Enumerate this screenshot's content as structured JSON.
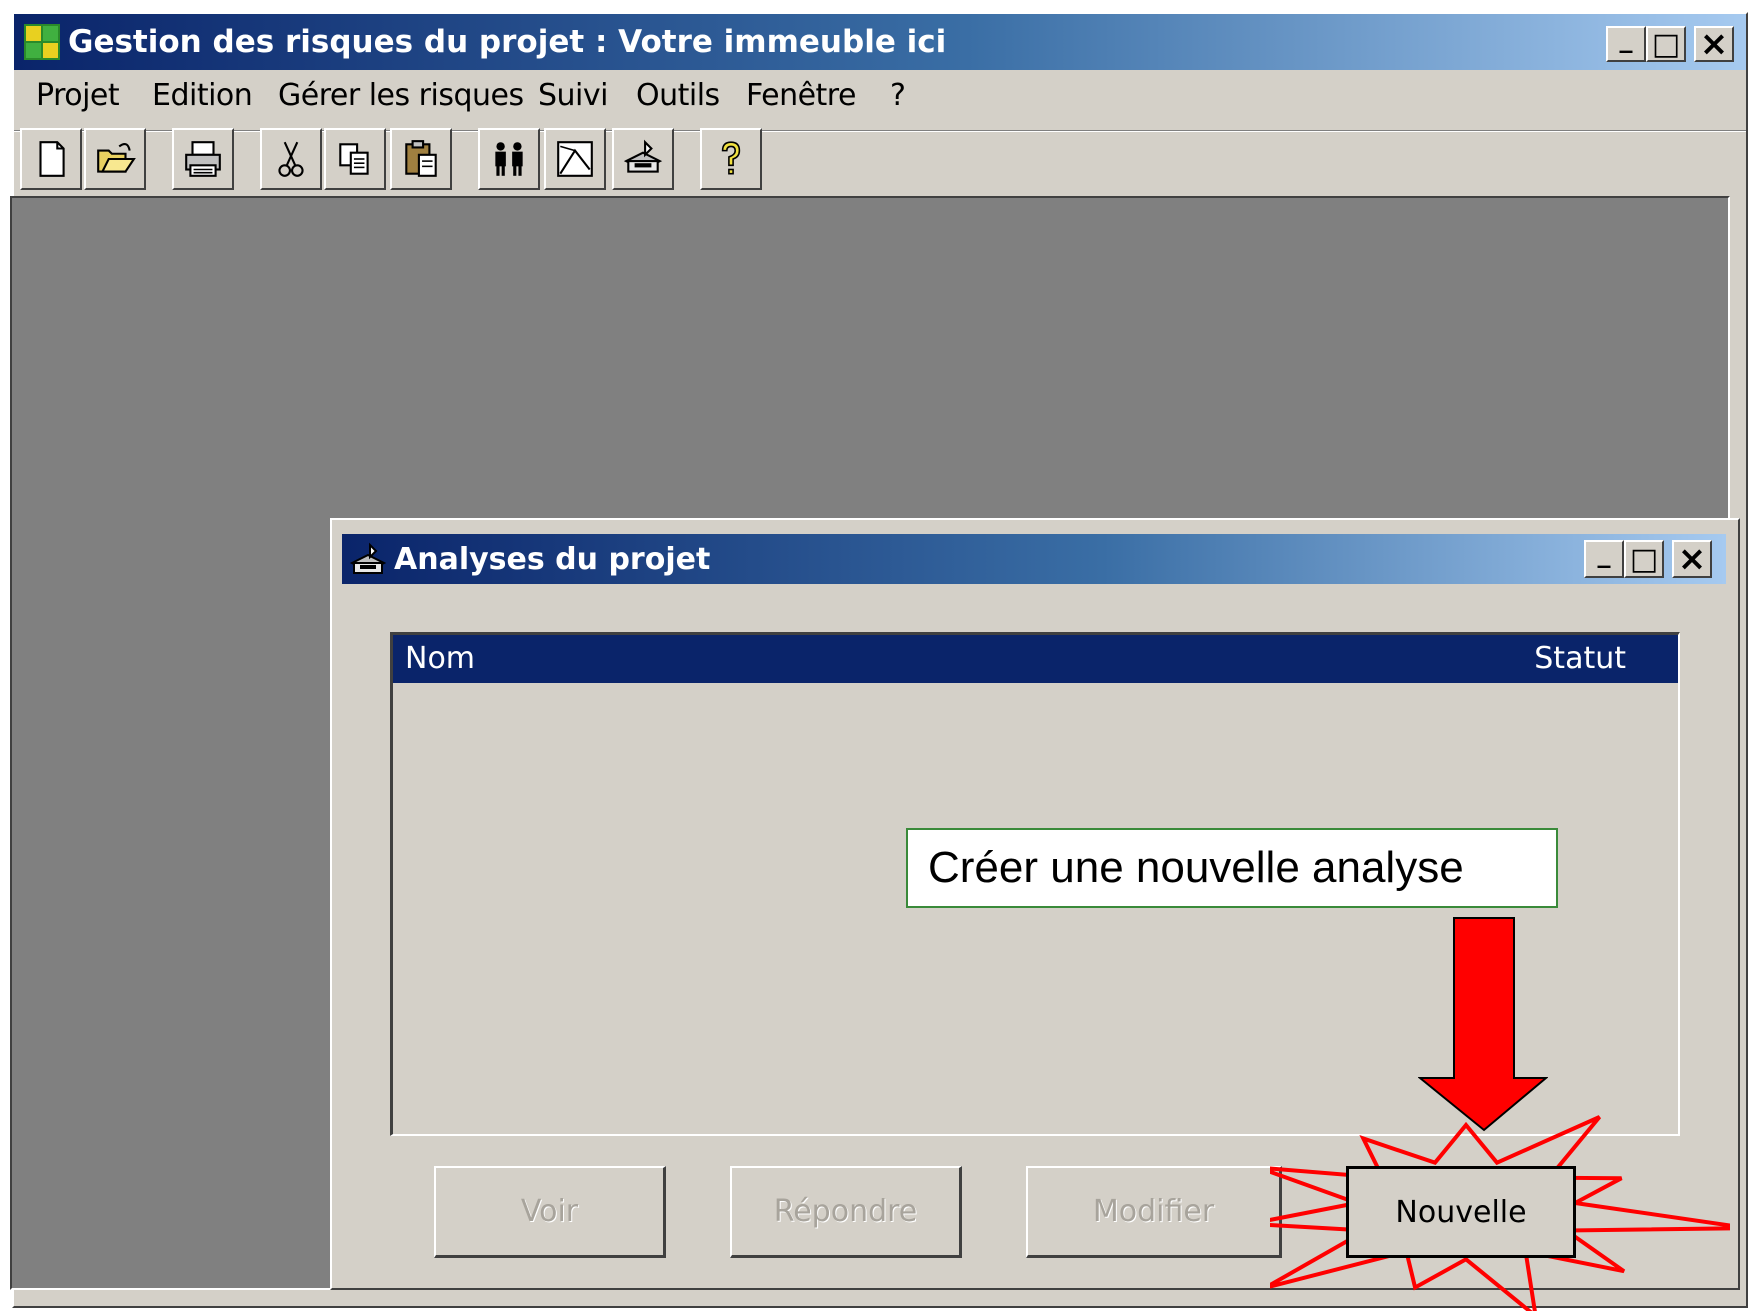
{
  "main_window": {
    "title": "Gestion des risques du projet : Votre immeuble ici",
    "controls": {
      "minimize": "_",
      "maximize": "□",
      "close": "×"
    }
  },
  "menu": {
    "items": [
      "Projet",
      "Edition",
      "Gérer les risques",
      "Suivi",
      "Outils",
      "Fenêtre",
      "?"
    ]
  },
  "toolbar": {
    "buttons": [
      "new-file-icon",
      "open-folder-icon",
      "print-icon",
      "cut-icon",
      "copy-icon",
      "paste-icon",
      "people-icon",
      "chart-icon",
      "analysis-icon",
      "help-icon"
    ]
  },
  "child_window": {
    "title": "Analyses du projet",
    "controls": {
      "minimize": "_",
      "maximize": "□",
      "close": "×"
    },
    "list": {
      "columns": [
        "Nom",
        "Statut"
      ],
      "rows": []
    },
    "buttons": {
      "voir": "Voir",
      "repondre": "Répondre",
      "modifier": "Modifier",
      "nouvelle": "Nouvelle"
    }
  },
  "annotation": {
    "callout_text": "Créer une nouvelle analyse",
    "arrow_color": "#ff0000",
    "burst_color": "#ff0000"
  }
}
